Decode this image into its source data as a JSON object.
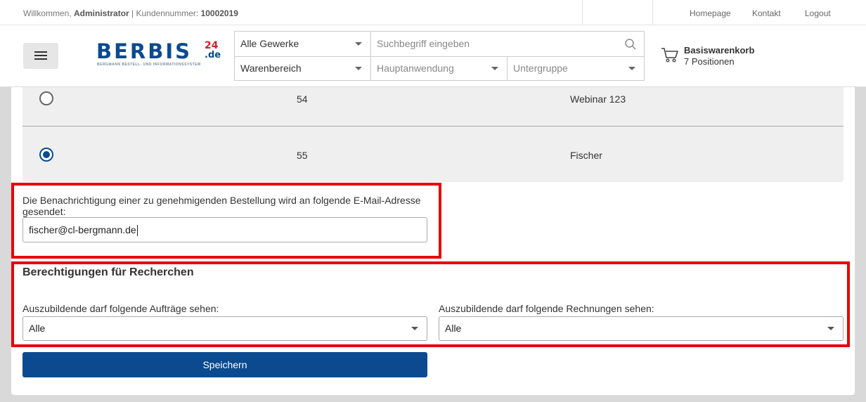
{
  "topbar": {
    "welcome_prefix": "Willkommen,",
    "user": "Administrator",
    "customer_label": "| Kundennummer:",
    "customer_number": "10002019",
    "links": {
      "homepage": "Homepage",
      "contact": "Kontakt",
      "logout": "Logout"
    }
  },
  "header": {
    "logo": {
      "word": "BERBIS",
      "num": "24",
      "tld": ".de",
      "tagline": "BERGMANN BESTELL- UND INFORMATIONSSYSTEM"
    },
    "search": {
      "trade": "Alle Gewerke",
      "placeholder": "Suchbegriff eingeben",
      "area": "Warenbereich",
      "main_use": "Hauptanwendung",
      "subgroup": "Untergruppe"
    },
    "cart": {
      "title": "Basiswarenkorb",
      "count": "7 Positionen"
    }
  },
  "rows": [
    {
      "number": "54",
      "name": "Webinar 123",
      "selected": false
    },
    {
      "number": "55",
      "name": "Fischer",
      "selected": true
    }
  ],
  "notification": {
    "label": "Die Benachrichtigung einer zu genehmigenden Bestellung wird an folgende E-Mail-Adresse gesendet:",
    "email": "fischer@cl-bergmann.de"
  },
  "permissions": {
    "title": "Berechtigungen für Recherchen",
    "orders_label": "Auszubildende darf folgende Aufträge sehen:",
    "orders_value": "Alle",
    "invoices_label": "Auszubildende darf folgende Rechnungen sehen:",
    "invoices_value": "Alle"
  },
  "save_label": "Speichern",
  "colors": {
    "brand_blue": "#0b4a8f",
    "highlight_red": "#e8000b",
    "logo_red": "#d32029"
  }
}
